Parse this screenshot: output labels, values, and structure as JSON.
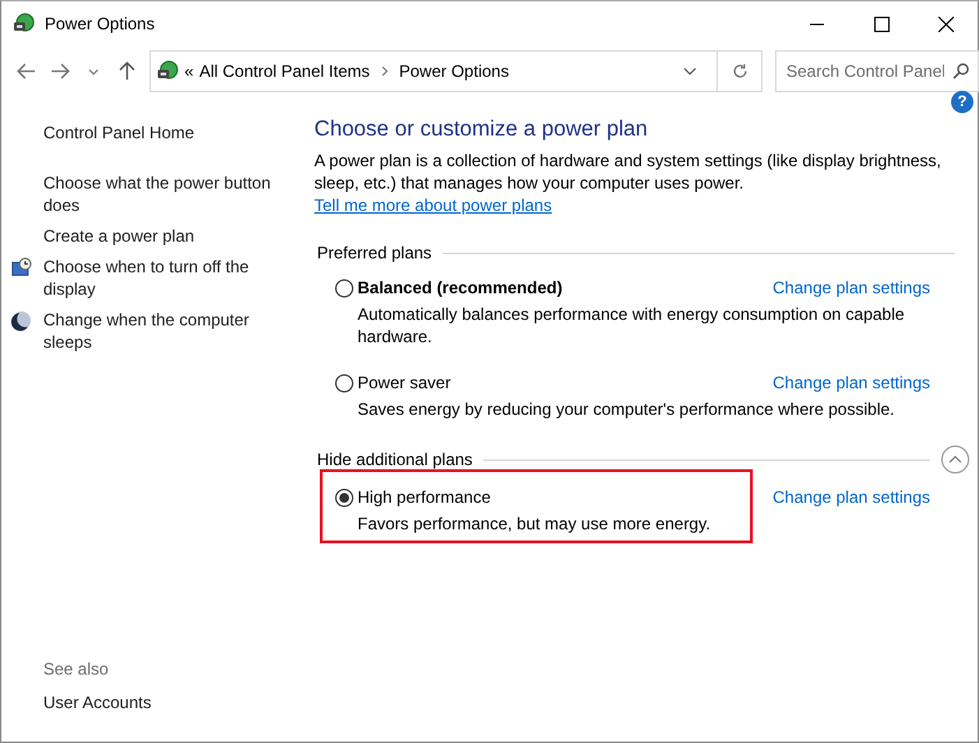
{
  "window": {
    "title": "Power Options"
  },
  "address_bar": {
    "overflow": "«",
    "crumbs": [
      "All Control Panel Items",
      "Power Options"
    ]
  },
  "search": {
    "placeholder": "Search Control Panel"
  },
  "sidebar": {
    "home": "Control Panel Home",
    "items": [
      {
        "label": "Choose what the power button does",
        "kind": "plain"
      },
      {
        "label": "Create a power plan",
        "kind": "plain"
      },
      {
        "label": "Choose when to turn off the display",
        "kind": "display"
      },
      {
        "label": "Change when the computer sleeps",
        "kind": "sleep"
      }
    ],
    "see_also": "See also",
    "see_also_links": [
      "User Accounts"
    ]
  },
  "content": {
    "help_button": "?",
    "heading": "Choose or customize a power plan",
    "description": "A power plan is a collection of hardware and system settings (like display brightness, sleep, etc.) that manages how your computer uses power.",
    "description_link": "Tell me more about power plans",
    "groups": [
      {
        "title": "Preferred plans",
        "collapse_button": false,
        "plans": [
          {
            "name": "Balanced (recommended)",
            "recommended": true,
            "selected": false,
            "highlighted": false,
            "description": "Automatically balances performance with energy consumption on capable hardware.",
            "link": "Change plan settings"
          },
          {
            "name": "Power saver",
            "recommended": false,
            "selected": false,
            "highlighted": false,
            "description": "Saves energy by reducing your computer's performance where possible.",
            "link": "Change plan settings"
          }
        ]
      },
      {
        "title": "Hide additional plans",
        "collapse_button": true,
        "plans": [
          {
            "name": "High performance",
            "recommended": false,
            "selected": true,
            "highlighted": true,
            "description": "Favors performance, but may use more energy.",
            "link": "Change plan settings"
          }
        ]
      }
    ]
  }
}
